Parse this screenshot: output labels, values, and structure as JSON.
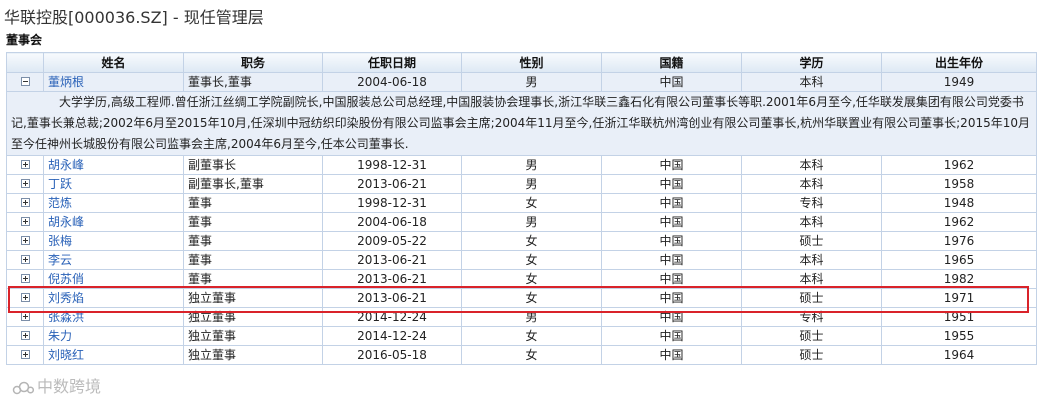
{
  "page": {
    "title": "华联控股[000036.SZ] - 现任管理层"
  },
  "section": {
    "title": "董事会"
  },
  "table": {
    "headers": [
      "",
      "姓名",
      "职务",
      "任职日期",
      "性别",
      "国籍",
      "学历",
      "出生年份"
    ],
    "rows": [
      {
        "toggle": "minus",
        "name": "董炳根",
        "position": "董事长,董事",
        "date": "2004-06-18",
        "gender": "男",
        "nationality": "中国",
        "education": "本科",
        "birth_year": "1949"
      },
      {
        "toggle": "plus",
        "name": "胡永峰",
        "position": "副董事长",
        "date": "1998-12-31",
        "gender": "男",
        "nationality": "中国",
        "education": "本科",
        "birth_year": "1962"
      },
      {
        "toggle": "plus",
        "name": "丁跃",
        "position": "副董事长,董事",
        "date": "2013-06-21",
        "gender": "男",
        "nationality": "中国",
        "education": "本科",
        "birth_year": "1958"
      },
      {
        "toggle": "plus",
        "name": "范炼",
        "position": "董事",
        "date": "1998-12-31",
        "gender": "女",
        "nationality": "中国",
        "education": "专科",
        "birth_year": "1948"
      },
      {
        "toggle": "plus",
        "name": "胡永峰",
        "position": "董事",
        "date": "2004-06-18",
        "gender": "男",
        "nationality": "中国",
        "education": "本科",
        "birth_year": "1962"
      },
      {
        "toggle": "plus",
        "name": "张梅",
        "position": "董事",
        "date": "2009-05-22",
        "gender": "女",
        "nationality": "中国",
        "education": "硕士",
        "birth_year": "1976"
      },
      {
        "toggle": "plus",
        "name": "李云",
        "position": "董事",
        "date": "2013-06-21",
        "gender": "女",
        "nationality": "中国",
        "education": "本科",
        "birth_year": "1965"
      },
      {
        "toggle": "plus",
        "name": "倪苏俏",
        "position": "董事",
        "date": "2013-06-21",
        "gender": "女",
        "nationality": "中国",
        "education": "本科",
        "birth_year": "1982"
      },
      {
        "toggle": "plus",
        "name": "刘秀焰",
        "position": "独立董事",
        "date": "2013-06-21",
        "gender": "女",
        "nationality": "中国",
        "education": "硕士",
        "birth_year": "1971"
      },
      {
        "toggle": "plus",
        "name": "张淼洪",
        "position": "独立董事",
        "date": "2014-12-24",
        "gender": "男",
        "nationality": "中国",
        "education": "专科",
        "birth_year": "1951"
      },
      {
        "toggle": "plus",
        "name": "朱力",
        "position": "独立董事",
        "date": "2014-12-24",
        "gender": "女",
        "nationality": "中国",
        "education": "硕士",
        "birth_year": "1955"
      },
      {
        "toggle": "plus",
        "name": "刘晓红",
        "position": "独立董事",
        "date": "2016-05-18",
        "gender": "女",
        "nationality": "中国",
        "education": "硕士",
        "birth_year": "1964"
      }
    ],
    "expanded_detail": "大学学历,高级工程师.曾任浙江丝绸工学院副院长,中国服装总公司总经理,中国服装协会理事长,浙江华联三鑫石化有限公司董事长等职.2001年6月至今,任华联发展集团有限公司党委书记,董事长兼总裁;2002年6月至2015年10月,任深圳中冠纺织印染股份有限公司监事会主席;2004年11月至今,任浙江华联杭州湾创业有限公司董事长,杭州华联置业有限公司董事长;2015年10月至今任神州长城股份有限公司监事会主席,2004年6月至今,任本公司董事长."
  },
  "highlight": {
    "row_name": "倪苏俏",
    "color": "#d9232a"
  },
  "watermark": {
    "text": "中数跨境"
  }
}
